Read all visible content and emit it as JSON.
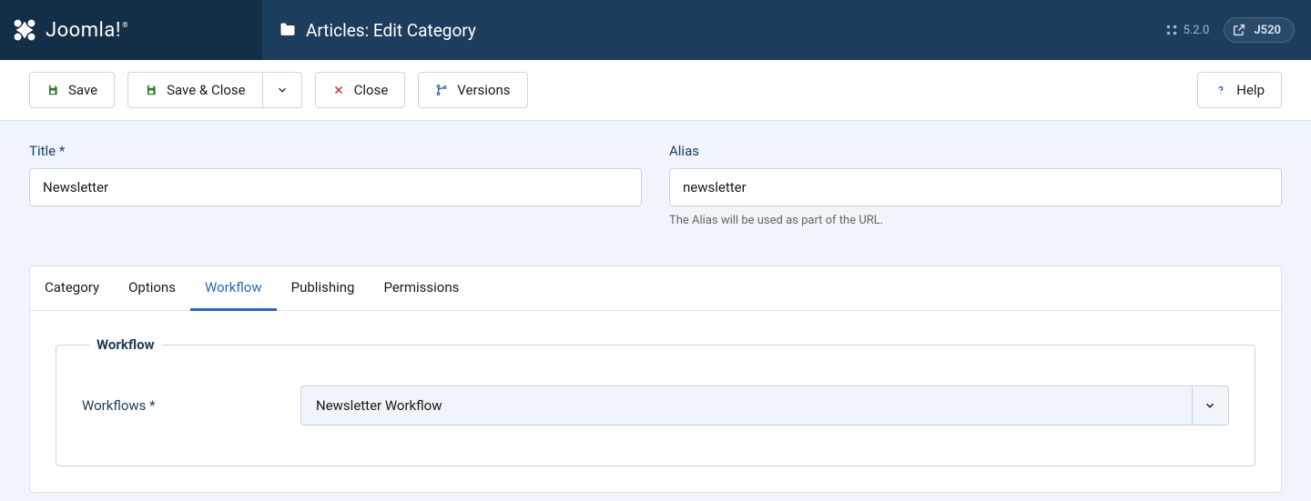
{
  "brand": {
    "name": "Joomla!"
  },
  "header": {
    "page_title": "Articles: Edit Category",
    "version": "5.2.0",
    "site_label": "J520"
  },
  "toolbar": {
    "save": "Save",
    "save_close": "Save & Close",
    "close": "Close",
    "versions": "Versions",
    "help": "Help"
  },
  "form": {
    "title_label": "Title *",
    "title_value": "Newsletter",
    "alias_label": "Alias",
    "alias_value": "newsletter",
    "alias_help": "The Alias will be used as part of the URL."
  },
  "tabs": {
    "items": [
      {
        "label": "Category"
      },
      {
        "label": "Options"
      },
      {
        "label": "Workflow"
      },
      {
        "label": "Publishing"
      },
      {
        "label": "Permissions"
      }
    ],
    "active_index": 2
  },
  "workflow": {
    "fieldset_legend": "Workflow",
    "field_label": "Workflows *",
    "selected": "Newsletter Workflow"
  }
}
